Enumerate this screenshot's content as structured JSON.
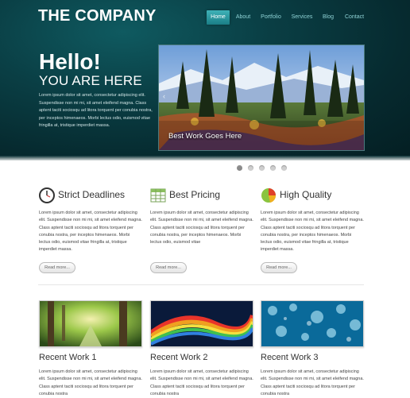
{
  "header": {
    "logo": "THE COMPANY",
    "nav": [
      "Home",
      "About",
      "Portfolio",
      "Services",
      "Blog",
      "Contact"
    ],
    "active_nav": "Home"
  },
  "hero": {
    "hello": "Hello!",
    "subtitle": "YOU ARE HERE",
    "text": "Lorem ipsum dolor sit amet, consectetur adipiscing elit. Suspendisse non mi mi, sit amet eleifend magna. Class aptent taciti sociosqu ad litora torquent per conubia nostra, per inceptos himenaeos. Morbi lectus odio, euismod vitae fringilla at, tristique imperdiet massa.",
    "slide_caption": "Best Work Goes Here",
    "slider_dots": 5,
    "active_dot": 1
  },
  "features": [
    {
      "title": "Strict Deadlines",
      "icon": "clock-icon",
      "text": "Lorem ipsum dolor sit amet, consectetur adipiscing elit. Suspendisse non mi mi, sit amet eleifend magna. Class aptent taciti sociosqu ad litora torquent per conubia nostra, per inceptos himenaeos. Morbi lectus odio, euismod vitae fringilla at, tristique imperdiet massa.",
      "button": "Read more..."
    },
    {
      "title": "Best Pricing",
      "icon": "spreadsheet-icon",
      "text": "Lorem ipsum dolor sit amet, consectetur adipiscing elit. Suspendisse non mi mi, sit amet eleifend magna. Class aptent taciti sociosqu ad litora torquent per conubia nostra, per inceptos himenaeos. Morbi lectus odio, euismod vitae",
      "button": "Read more..."
    },
    {
      "title": "High Quality",
      "icon": "pie-chart-icon",
      "text": "Lorem ipsum dolor sit amet, consectetur adipiscing elit. Suspendisse non mi mi, sit amet eleifend magna. Class aptent taciti sociosqu ad litora torquent per conubia nostra, per inceptos himenaeos. Morbi lectus odio, euismod vitae fringilla at, tristique imperdiet massa.",
      "button": "Read more..."
    }
  ],
  "works": [
    {
      "title": "Recent Work 1",
      "text": "Lorem ipsum dolor sit amet, consectetur adipiscing elit. Suspendisse non mi mi, sit amet eleifend magna. Class aptent taciti sociosqu ad litora torquent per conubia nostra"
    },
    {
      "title": "Recent Work 2",
      "text": "Lorem ipsum dolor sit amet, consectetur adipiscing elit. Suspendisse non mi mi, sit amet eleifend magna. Class aptent taciti sociosqu ad litora torquent per conubia nostra"
    },
    {
      "title": "Recent Work 3",
      "text": "Lorem ipsum dolor sit amet, consectetur adipiscing elit. Suspendisse non mi mi, sit amet eleifend magna. Class aptent taciti sociosqu ad litora torquent per conubia nostra"
    }
  ],
  "colors": {
    "hero_bg": "#062a2f",
    "nav_active": "#2a9aa1",
    "nav_text": "#8fd3d6"
  }
}
